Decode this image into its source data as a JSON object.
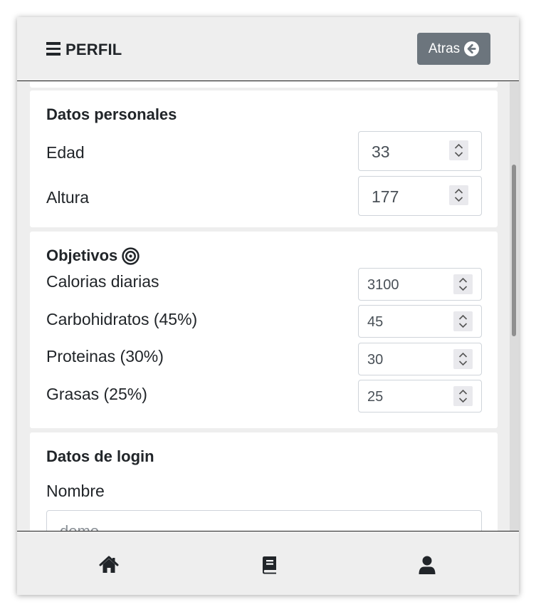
{
  "header": {
    "title": "PERFIL",
    "back_label": "Atras"
  },
  "personal": {
    "title": "Datos personales",
    "fields": [
      {
        "label": "Edad",
        "value": "33"
      },
      {
        "label": "Altura",
        "value": "177"
      }
    ]
  },
  "objectives": {
    "title": "Objetivos",
    "fields": [
      {
        "label": "Calorias diarias",
        "value": "3100"
      },
      {
        "label": "Carbohidratos (45%)",
        "value": "45"
      },
      {
        "label": "Proteinas (30%)",
        "value": "30"
      },
      {
        "label": "Grasas (25%)",
        "value": "25"
      }
    ]
  },
  "login": {
    "title": "Datos de login",
    "name_label": "Nombre",
    "name_placeholder": "demo"
  },
  "nav": {
    "items": [
      "home-icon",
      "book-icon",
      "user-icon"
    ]
  },
  "colors": {
    "back_button": "#6c757d",
    "background": "#eeeeee"
  }
}
